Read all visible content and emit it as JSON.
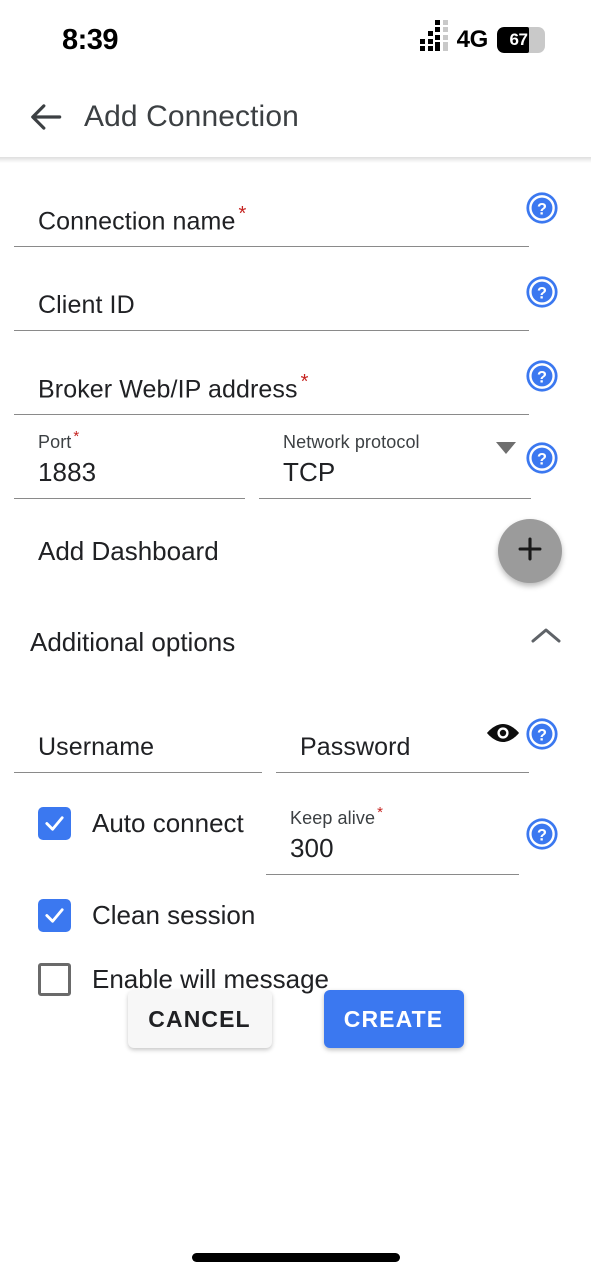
{
  "status_bar": {
    "time": "8:39",
    "network_label": "4G",
    "battery_percent": "67",
    "signal_icon": "signal-bars-icon",
    "battery_icon": "battery-icon"
  },
  "app_bar": {
    "back_icon": "back-arrow-icon",
    "title": "Add Connection"
  },
  "form": {
    "fields": [
      {
        "label": "Connection name",
        "required": true,
        "value": "",
        "help_icon": "help-circle-icon"
      },
      {
        "label": "Client ID",
        "required": false,
        "value": "",
        "help_icon": "help-circle-icon"
      },
      {
        "label": "Broker Web/IP address",
        "required": true,
        "value": "",
        "help_icon": "help-circle-icon"
      }
    ],
    "port": {
      "label": "Port",
      "required": true,
      "value": "1883"
    },
    "network_protocol": {
      "label": "Network protocol",
      "value": "TCP",
      "dropdown_icon": "chevron-down-icon",
      "options": [
        "TCP"
      ]
    },
    "port_row_help_icon": "help-circle-icon",
    "add_dashboard": {
      "label": "Add Dashboard",
      "add_icon": "plus-icon"
    },
    "additional_options": {
      "label": "Additional options",
      "expanded": true,
      "toggle_icon": "chevron-up-icon"
    },
    "username": {
      "label": "Username",
      "value": ""
    },
    "password": {
      "label": "Password",
      "value": "",
      "visibility_icon": "eye-icon"
    },
    "credentials_help_icon": "help-circle-icon",
    "auto_connect": {
      "label": "Auto connect",
      "checked": true
    },
    "keep_alive": {
      "label": "Keep alive",
      "required": true,
      "value": "300"
    },
    "keep_alive_help_icon": "help-circle-icon",
    "clean_session": {
      "label": "Clean session",
      "checked": true
    },
    "enable_will_message": {
      "label": "Enable will message",
      "checked": false
    }
  },
  "actions": {
    "cancel_label": "CANCEL",
    "create_label": "CREATE"
  },
  "colors": {
    "accent_blue": "#3b78f0",
    "required_red": "#c5221f",
    "fab_gray": "#9b9b9b",
    "text_primary": "#202124",
    "underline_gray": "#8a8a8a"
  }
}
